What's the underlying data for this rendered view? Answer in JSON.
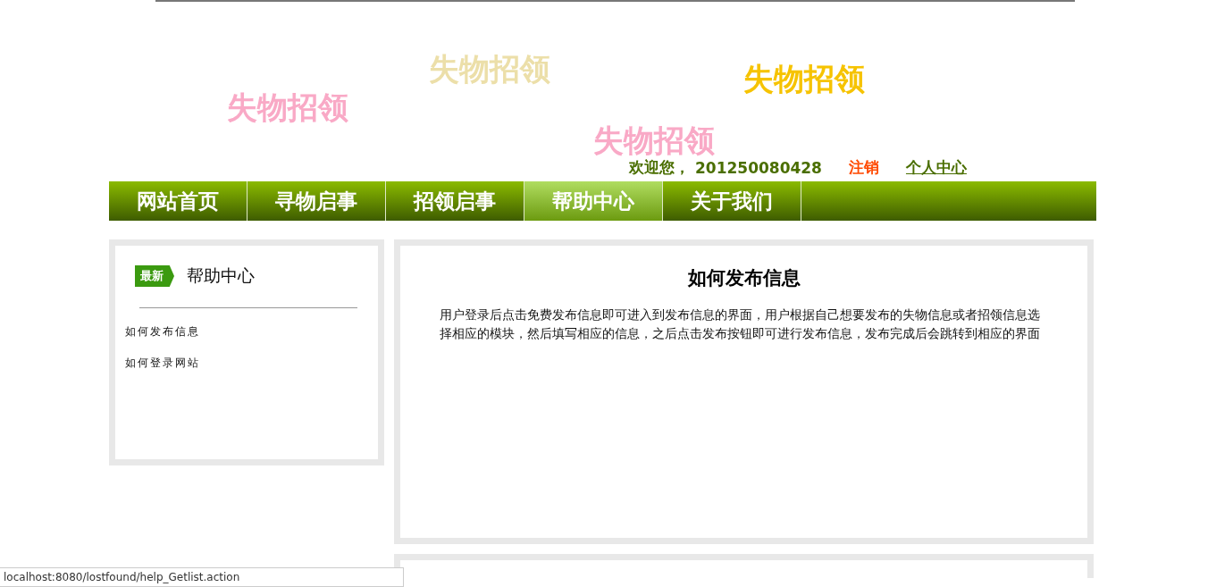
{
  "banner": {
    "slogans": [
      {
        "text": "失物招领",
        "color": "#f9a9c6"
      },
      {
        "text": "失物招领",
        "color": "#ecdfa9"
      },
      {
        "text": "失物招领",
        "color": "#f6c300"
      },
      {
        "text": "失物招领",
        "color": "#f9a9c6"
      }
    ]
  },
  "user_bar": {
    "welcome": "欢迎您，",
    "user_id": "201250080428",
    "logout": "注销",
    "profile": "个人中心"
  },
  "nav": [
    {
      "label": "网站首页",
      "selected": false
    },
    {
      "label": "寻物启事",
      "selected": false
    },
    {
      "label": "招领启事",
      "selected": false
    },
    {
      "label": "帮助中心",
      "selected": true
    },
    {
      "label": "关于我们",
      "selected": false
    }
  ],
  "sidebar": {
    "badge": "最新",
    "title": "帮助中心",
    "items": [
      "如何发布信息",
      "如何登录网站"
    ]
  },
  "article": {
    "title": "如何发布信息",
    "body": "用户登录后点击免费发布信息即可进入到发布信息的界面，用户根据自己想要发布的失物信息或者招领信息选择相应的模块，然后填写相应的信息，之后点击发布按钮即可进行发布信息，发布完成后会跳转到相应的界面"
  },
  "status_bar": {
    "url": "localhost:8080/lostfound/help_Getlist.action"
  }
}
